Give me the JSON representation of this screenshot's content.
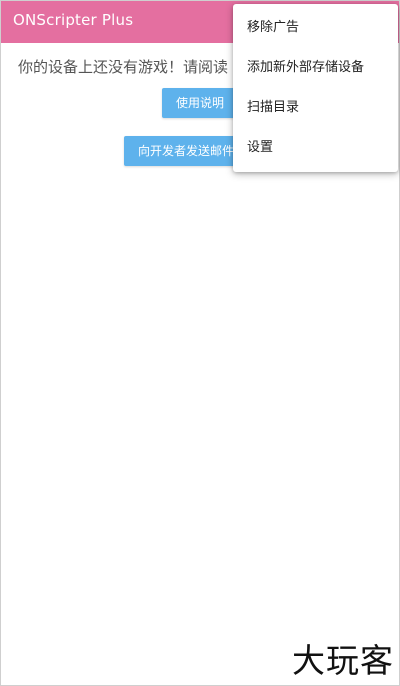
{
  "app": {
    "title": "ONScripter Plus"
  },
  "main": {
    "message": "你的设备上还没有游戏！请阅读",
    "manual_button": "使用说明",
    "email_button": "向开发者发送邮件"
  },
  "overflow_menu": {
    "items": [
      {
        "label": "移除广告"
      },
      {
        "label": "添加新外部存储设备"
      },
      {
        "label": "扫描目录"
      },
      {
        "label": "设置"
      }
    ]
  },
  "watermark": {
    "text": "大玩客"
  },
  "colors": {
    "appbar": "#e46fa0",
    "button": "#5eb2ec"
  }
}
